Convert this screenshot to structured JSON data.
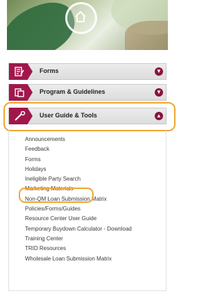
{
  "banner": {
    "icon": "house-icon"
  },
  "menu": [
    {
      "label": "Forms",
      "icon": "document-pencil-icon",
      "expanded": false
    },
    {
      "label": "Program & Guidelines",
      "icon": "document-folder-icon",
      "expanded": false
    },
    {
      "label": "User Guide & Tools",
      "icon": "wrench-icon",
      "expanded": true
    }
  ],
  "submenu": [
    "Announcements",
    "Feedback",
    "Forms",
    "Holidays",
    "Ineligible Party Search",
    "Marketing Materials",
    "Non-QM Loan Submission Matrix",
    "Policies/Forms/Guides",
    "Resource Center User Guide",
    "Temporary Buydown Calculator - Download",
    "Training Center",
    "TRID Resources",
    "Wholesale Loan Submission Matrix"
  ],
  "colors": {
    "accent": "#a0184b",
    "highlight": "#f0a530"
  }
}
